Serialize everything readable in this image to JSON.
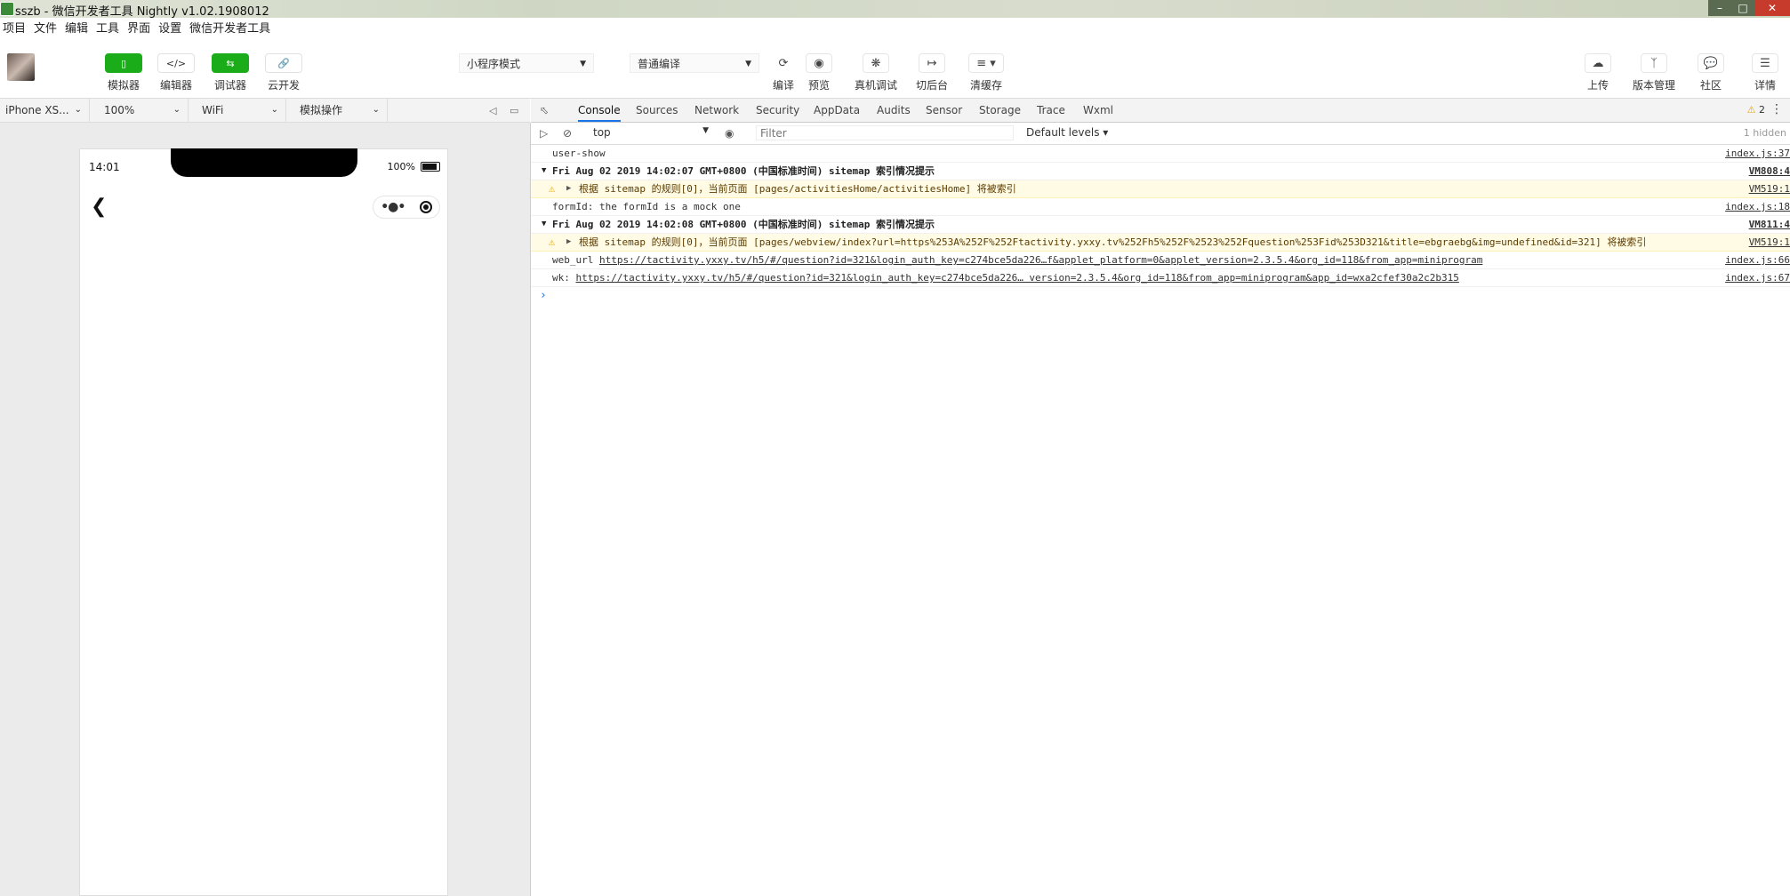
{
  "window": {
    "title": "sszb - 微信开发者工具 Nightly v1.02.1908012"
  },
  "menu": [
    "项目",
    "文件",
    "编辑",
    "工具",
    "界面",
    "设置",
    "微信开发者工具"
  ],
  "toolbar": {
    "left": [
      {
        "name": "simulator",
        "label": "模拟器",
        "icon": "phone-icon"
      },
      {
        "name": "editor",
        "label": "编辑器",
        "icon": "code-icon"
      },
      {
        "name": "debugger",
        "label": "调试器",
        "icon": "debug-icon"
      },
      {
        "name": "cloud",
        "label": "云开发",
        "icon": "link-icon"
      }
    ],
    "mode_select": "小程序模式",
    "compile_select": "普通编译",
    "center": [
      {
        "name": "compile",
        "label": "编译",
        "icon": "refresh-icon"
      },
      {
        "name": "preview",
        "label": "预览",
        "icon": "eye-icon"
      },
      {
        "name": "remote-debug",
        "label": "真机调试",
        "icon": "bug-icon"
      },
      {
        "name": "background",
        "label": "切后台",
        "icon": "arrow-icon"
      },
      {
        "name": "clear-cache",
        "label": "清缓存",
        "icon": "layers-icon"
      }
    ],
    "right": [
      {
        "name": "upload",
        "label": "上传",
        "icon": "cloud-upload-icon"
      },
      {
        "name": "version",
        "label": "版本管理",
        "icon": "branch-icon"
      },
      {
        "name": "community",
        "label": "社区",
        "icon": "chat-icon"
      },
      {
        "name": "details",
        "label": "详情",
        "icon": "menu-icon"
      }
    ]
  },
  "simbar": {
    "device": "iPhone XS...",
    "zoom": "100%",
    "network": "WiFi",
    "action": "模拟操作"
  },
  "phone": {
    "time": "14:01",
    "battery": "100%"
  },
  "devtools": {
    "tabs": [
      "Console",
      "Sources",
      "Network",
      "Security",
      "AppData",
      "Audits",
      "Sensor",
      "Storage",
      "Trace",
      "Wxml"
    ],
    "active_tab": "Console",
    "warnings": "2",
    "context": "top",
    "filter_placeholder": "Filter",
    "levels": "Default levels",
    "hidden": "1 hidden"
  },
  "console": {
    "r1": {
      "text": "user-show",
      "src": "index.js:37"
    },
    "r2": {
      "text": "Fri Aug 02 2019 14:02:07 GMT+0800 (中国标准时间) sitemap 索引情况提示",
      "src": "VM808:4"
    },
    "r3": {
      "text": "根据 sitemap 的规则[0]，当前页面 [pages/activitiesHome/activitiesHome] 将被索引",
      "src": "VM519:1"
    },
    "r4": {
      "text": "formId: the formId is a mock one",
      "src": "index.js:18"
    },
    "r5": {
      "text": "Fri Aug 02 2019 14:02:08 GMT+0800 (中国标准时间) sitemap 索引情况提示",
      "src": "VM811:4"
    },
    "r6": {
      "text": "根据 sitemap 的规则[0]，当前页面 [pages/webview/index?url=https%253A%252F%252Ftactivity.yxxy.tv%252Fh5%252F%2523%252Fquestion%253Fid%253D321&title=ebgraebg&img=undefined&id=321] 将被索引",
      "src": "VM519:1"
    },
    "r7": {
      "prefix": "web_url",
      "link": "https://tactivity.yxxy.tv/h5/#/question?id=321&login_auth_key=c274bce5da226…f&applet_platform=0&applet_version=2.3.5.4&org_id=118&from_app=miniprogram",
      "src": "index.js:66"
    },
    "r8": {
      "prefix": "wk:",
      "link": "https://tactivity.yxxy.tv/h5/#/question?id=321&login_auth_key=c274bce5da226… version=2.3.5.4&org_id=118&from_app=miniprogram&app_id=wxa2cfef30a2c2b315",
      "src": "index.js:67"
    }
  }
}
